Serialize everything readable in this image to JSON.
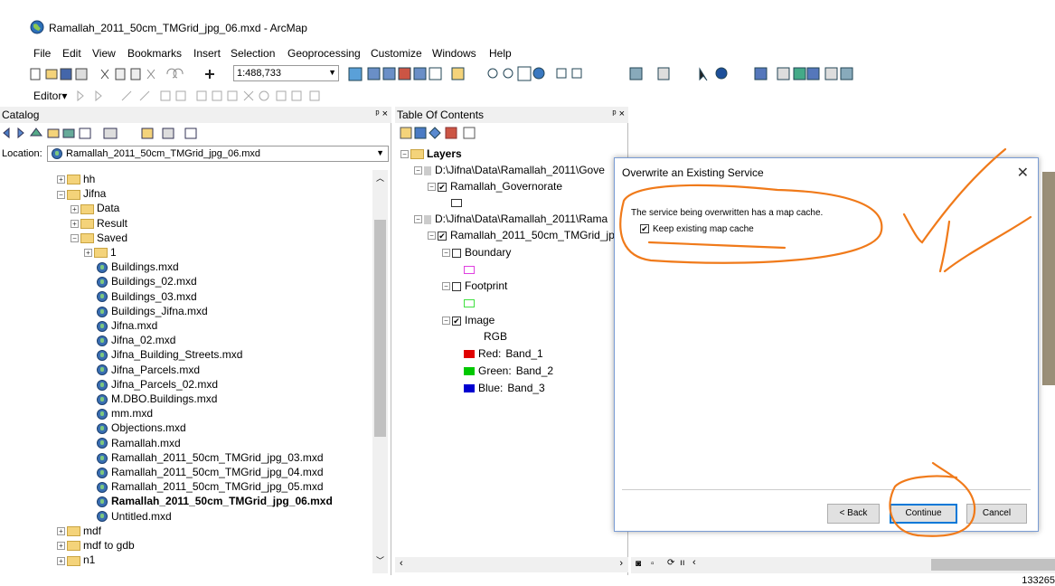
{
  "window": {
    "title": "Ramallah_2011_50cm_TMGrid_jpg_06.mxd - ArcMap"
  },
  "menu": [
    "File",
    "Edit",
    "View",
    "Bookmarks",
    "Insert",
    "Selection",
    "Geoprocessing",
    "Customize",
    "Windows",
    "Help"
  ],
  "toolbar": {
    "scale": "1:488,733",
    "editor_label": "Editor"
  },
  "catalog": {
    "title": "Catalog",
    "location_label": "Location:",
    "location_value": "Ramallah_2011_50cm_TMGrid_jpg_06.mxd",
    "items": [
      {
        "label": "hh",
        "type": "folder",
        "level": 1,
        "expander": "+"
      },
      {
        "label": "Jifna",
        "type": "folder",
        "level": 1,
        "expander": "-"
      },
      {
        "label": "Data",
        "type": "folder",
        "level": 2,
        "expander": "+"
      },
      {
        "label": "Result",
        "type": "folder",
        "level": 2,
        "expander": "+"
      },
      {
        "label": "Saved",
        "type": "folder",
        "level": 2,
        "expander": "-"
      },
      {
        "label": "1",
        "type": "folder",
        "level": 3,
        "expander": "+"
      },
      {
        "label": "Buildings.mxd",
        "type": "mxd",
        "level": 3
      },
      {
        "label": "Buildings_02.mxd",
        "type": "mxd",
        "level": 3
      },
      {
        "label": "Buildings_03.mxd",
        "type": "mxd",
        "level": 3
      },
      {
        "label": "Buildings_Jifna.mxd",
        "type": "mxd",
        "level": 3
      },
      {
        "label": "Jifna.mxd",
        "type": "mxd",
        "level": 3
      },
      {
        "label": "Jifna_02.mxd",
        "type": "mxd",
        "level": 3
      },
      {
        "label": "Jifna_Building_Streets.mxd",
        "type": "mxd",
        "level": 3
      },
      {
        "label": "Jifna_Parcels.mxd",
        "type": "mxd",
        "level": 3
      },
      {
        "label": "Jifna_Parcels_02.mxd",
        "type": "mxd",
        "level": 3
      },
      {
        "label": "M.DBO.Buildings.mxd",
        "type": "mxd",
        "level": 3
      },
      {
        "label": "mm.mxd",
        "type": "mxd",
        "level": 3
      },
      {
        "label": "Objections.mxd",
        "type": "mxd",
        "level": 3
      },
      {
        "label": "Ramallah.mxd",
        "type": "mxd",
        "level": 3
      },
      {
        "label": "Ramallah_2011_50cm_TMGrid_jpg_03.mxd",
        "type": "mxd",
        "level": 3
      },
      {
        "label": "Ramallah_2011_50cm_TMGrid_jpg_04.mxd",
        "type": "mxd",
        "level": 3
      },
      {
        "label": "Ramallah_2011_50cm_TMGrid_jpg_05.mxd",
        "type": "mxd",
        "level": 3
      },
      {
        "label": "Ramallah_2011_50cm_TMGrid_jpg_06.mxd",
        "type": "mxd",
        "level": 3,
        "bold": true
      },
      {
        "label": "Untitled.mxd",
        "type": "mxd",
        "level": 3
      },
      {
        "label": "mdf",
        "type": "folder",
        "level": 1,
        "expander": "+"
      },
      {
        "label": "mdf to gdb",
        "type": "folder",
        "level": 1,
        "expander": "+"
      },
      {
        "label": "n1",
        "type": "folder",
        "level": 1,
        "expander": "+"
      }
    ]
  },
  "toc": {
    "title": "Table Of Contents",
    "layers_label": "Layers",
    "group1_path": "D:\\Jifna\\Data\\Ramallah_2011\\Gove",
    "group1_layer": "Ramallah_Governorate",
    "group2_path": "D:\\Jifna\\Data\\Ramallah_2011\\Rama",
    "group2_layer": "Ramallah_2011_50cm_TMGrid_jp",
    "boundary": "Boundary",
    "footprint": "Footprint",
    "image": "Image",
    "rgb": "RGB",
    "bands": [
      {
        "label": "Red:",
        "value": "Band_1",
        "color": "#e00000"
      },
      {
        "label": "Green:",
        "value": "Band_2",
        "color": "#00c800"
      },
      {
        "label": "Blue:",
        "value": "Band_3",
        "color": "#0000d0"
      }
    ],
    "boundary_color": "#e040e0",
    "footprint_color": "#40e040"
  },
  "dialog": {
    "title": "Overwrite an Existing Service",
    "message": "The service being overwritten has a map cache.",
    "checkbox_label": "Keep existing map cache",
    "checkbox_checked": true,
    "back_label": "< Back",
    "continue_label": "Continue",
    "cancel_label": "Cancel"
  },
  "status": {
    "coordinate": "133265"
  },
  "colors": {
    "annotation": "#f07a1a",
    "dialog_border": "#7a9cd4"
  }
}
